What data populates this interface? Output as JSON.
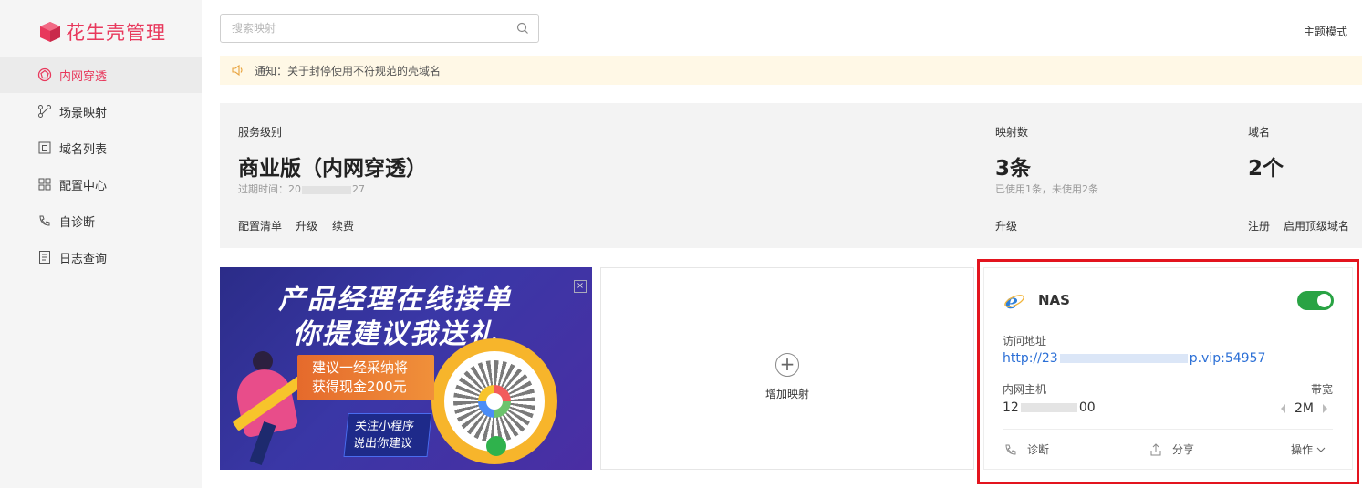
{
  "brand": {
    "name": "花生壳管理",
    "accent": "#e8385c"
  },
  "sidebar": {
    "items": [
      {
        "label": "内网穿透",
        "icon": "network-icon",
        "active": true
      },
      {
        "label": "场景映射",
        "icon": "scene-icon"
      },
      {
        "label": "域名列表",
        "icon": "domain-icon"
      },
      {
        "label": "配置中心",
        "icon": "grid-icon"
      },
      {
        "label": "自诊断",
        "icon": "diagnose-icon"
      },
      {
        "label": "日志查询",
        "icon": "log-icon"
      }
    ]
  },
  "search": {
    "placeholder": "搜索映射",
    "value": ""
  },
  "header": {
    "theme_mode": "主题模式"
  },
  "notice": {
    "text": "通知：关于封停使用不符规范的壳域名"
  },
  "summary": {
    "service": {
      "label": "服务级别",
      "value": "商业版（内网穿透）",
      "expire": "过期时间：20",
      "expire_tail": "27",
      "links": [
        "配置清单",
        "升级",
        "续费"
      ]
    },
    "mappings": {
      "label": "映射数",
      "value": "3条",
      "sub": "已使用1条，未使用2条",
      "link": "升级"
    },
    "domains": {
      "label": "域名",
      "value": "2个",
      "links": [
        "注册",
        "启用顶级域名"
      ]
    }
  },
  "banner": {
    "line1": "产品经理在线接单",
    "line2": "你提建议我送礼",
    "tag_line1": "建议一经采纳将",
    "tag_line2": "获得现金200元",
    "tag2_line1": "关注小程序",
    "tag2_line2": "说出你建议",
    "close": "×"
  },
  "add_card": {
    "plus": "+",
    "label": "增加映射"
  },
  "mapping_card": {
    "name": "NAS",
    "enabled": true,
    "addr_label": "访问地址",
    "addr_prefix": "http://23",
    "addr_suffix": "p.vip:54957",
    "host_label": "内网主机",
    "host_prefix": "12",
    "host_suffix": "00",
    "bandwidth_label": "带宽",
    "bandwidth": "2M",
    "actions": {
      "diagnose": "诊断",
      "share": "分享",
      "ops": "操作"
    },
    "toggle_color": "#29a344"
  }
}
